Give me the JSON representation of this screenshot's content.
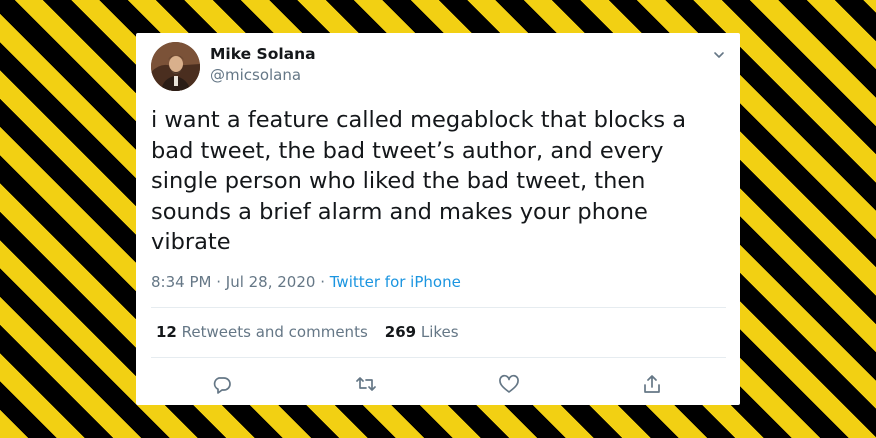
{
  "tweet": {
    "author_name": "Mike Solana",
    "author_handle": "@micsolana",
    "text": "i want a feature called megablock that blocks a bad tweet, the bad tweet’s author, and every single person who liked the bad tweet, then sounds a brief alarm and makes your phone vibrate",
    "time": "8:34 PM",
    "separator": " · ",
    "date": "Jul 28, 2020",
    "source": "Twitter for iPhone"
  },
  "stats": {
    "retweets_count": "12",
    "retweets_label": " Retweets and comments",
    "likes_count": "269",
    "likes_label": " Likes"
  },
  "icons": {
    "reply": "reply-icon",
    "retweet": "retweet-icon",
    "like": "heart-icon",
    "share": "share-icon",
    "menu": "chevron-down-icon"
  },
  "colors": {
    "stripe_yellow": "#f2d013",
    "stripe_black": "#000000",
    "link_blue": "#1b95e0",
    "muted_gray": "#657786",
    "text_dark": "#14171a"
  }
}
